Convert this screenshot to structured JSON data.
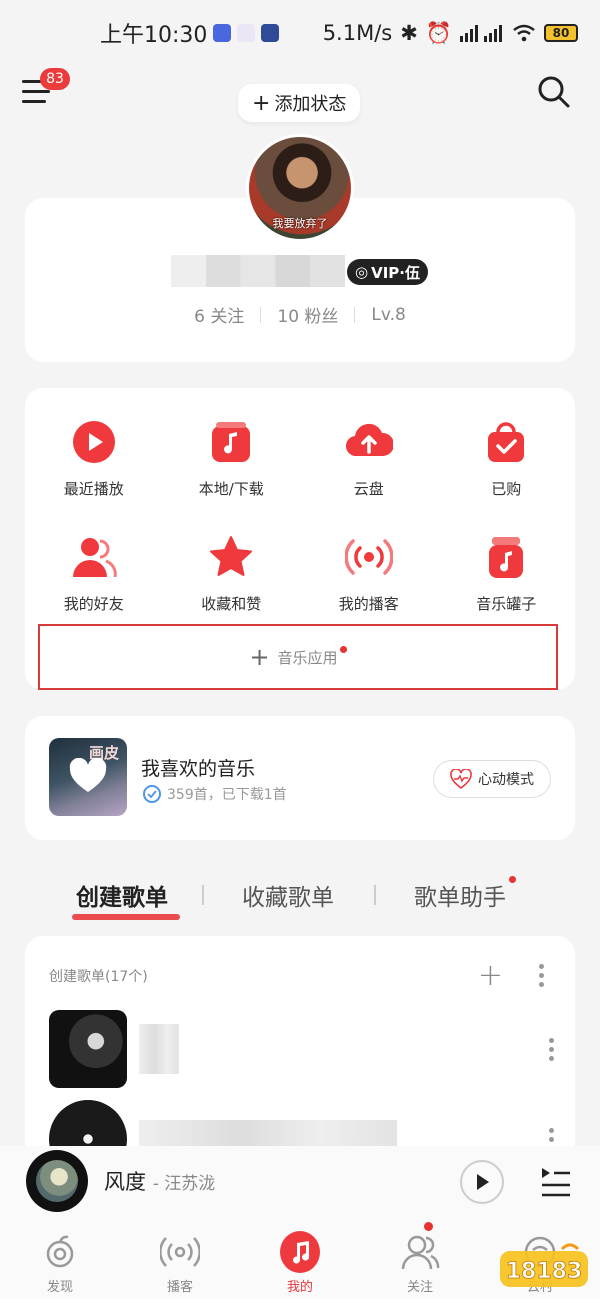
{
  "status_bar": {
    "time": "上午10:30",
    "network_speed": "5.1M/s",
    "battery": "80"
  },
  "header": {
    "notification_count": "83",
    "add_status_label": "添加状态"
  },
  "profile": {
    "avatar_caption": "我要放弃了",
    "vip_label": "VIP·伍",
    "following": "6 关注",
    "followers": "10 粉丝",
    "level": "Lv.8"
  },
  "quick_actions": [
    {
      "label": "最近播放",
      "icon": "play-circle-icon"
    },
    {
      "label": "本地/下载",
      "icon": "music-note-box-icon"
    },
    {
      "label": "云盘",
      "icon": "cloud-upload-icon"
    },
    {
      "label": "已购",
      "icon": "shopping-bag-icon"
    },
    {
      "label": "我的好友",
      "icon": "friends-icon"
    },
    {
      "label": "收藏和赞",
      "icon": "star-icon"
    },
    {
      "label": "我的播客",
      "icon": "broadcast-icon"
    },
    {
      "label": "音乐罐子",
      "icon": "music-jar-icon"
    }
  ],
  "music_app": {
    "label": "音乐应用"
  },
  "liked_music": {
    "title": "我喜欢的音乐",
    "subtitle": "359首，已下载1首",
    "cover_text": "画皮",
    "heartbeat_mode": "心动模式"
  },
  "playlist_tabs": [
    {
      "label": "创建歌单",
      "active": true
    },
    {
      "label": "收藏歌单",
      "active": false
    },
    {
      "label": "歌单助手",
      "active": false
    }
  ],
  "created_playlists": {
    "header": "创建歌单(17个)"
  },
  "mini_player": {
    "song": "风度",
    "artist": "汪苏泷"
  },
  "bottom_nav": [
    {
      "label": "发现",
      "icon": "discover-icon"
    },
    {
      "label": "播客",
      "icon": "podcast-icon"
    },
    {
      "label": "我的",
      "icon": "my-music-icon",
      "active": true
    },
    {
      "label": "关注",
      "icon": "follow-icon"
    },
    {
      "label": "云村",
      "icon": "cloud-village-icon"
    }
  ],
  "colors": {
    "accent": "#e8383d",
    "background": "#f4f4f5",
    "card": "#ffffff"
  }
}
